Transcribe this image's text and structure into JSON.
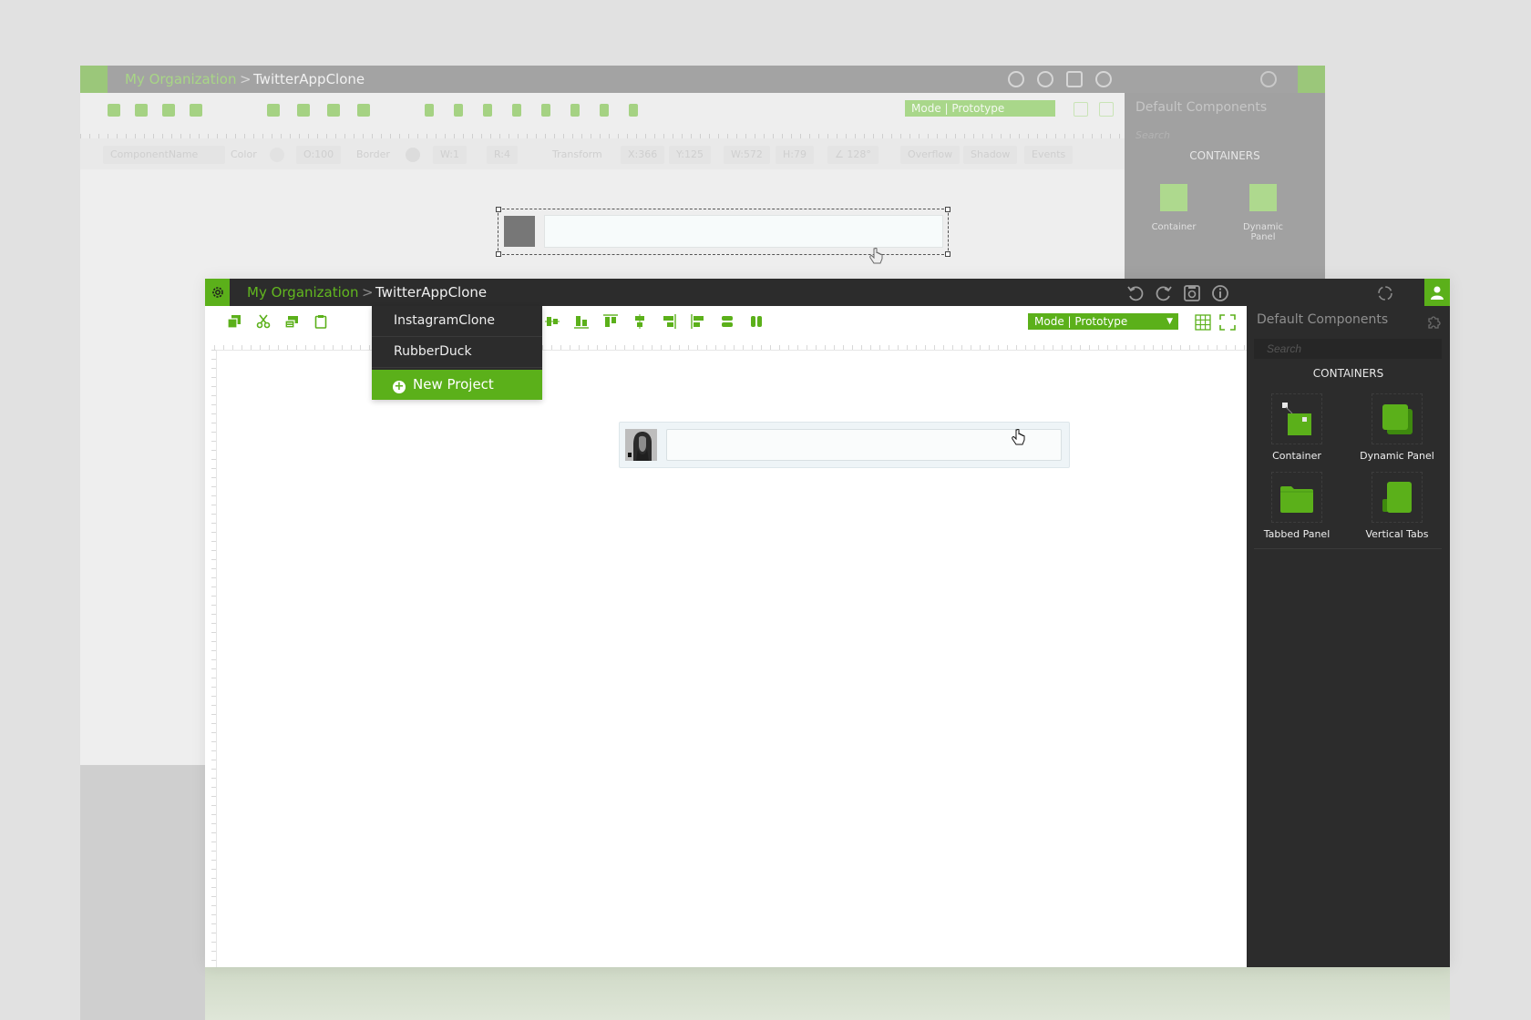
{
  "background_window": {
    "org": "My Organization",
    "separator": ">",
    "project": "TwitterAppClone",
    "mode": "Mode | Prototype",
    "sidebar_title": "Default Components",
    "search_placeholder": "Search",
    "section": "CONTAINERS",
    "components": [
      "Container",
      "Dynamic Panel"
    ],
    "props": {
      "name": "ComponentName",
      "color": "Color",
      "opacity": "O:100",
      "border": "Border",
      "width_line": "W:1",
      "radius": "R:4",
      "transform": "Transform",
      "x": "X:366",
      "y": "Y:125",
      "w": "W:572",
      "h": "H:79",
      "angle": "∠ 128°",
      "overflow": "Overflow",
      "shadow": "Shadow",
      "events": "Events"
    }
  },
  "topbar": {
    "org": "My Organization",
    "separator": ">",
    "project": "TwitterAppClone"
  },
  "project_dropdown": {
    "items": [
      "InstagramClone",
      "RubberDuck"
    ],
    "new_project": "New Project"
  },
  "toolbar": {
    "mode": "Mode | Prototype"
  },
  "canvas": {
    "input_value": ""
  },
  "sidebar": {
    "title": "Default Components",
    "search_placeholder": "Search",
    "section": "CONTAINERS",
    "components": [
      {
        "label": "Container",
        "icon": "container-icon"
      },
      {
        "label": "Dynamic Panel",
        "icon": "dynamic-panel-icon"
      },
      {
        "label": "Tabbed Panel",
        "icon": "tabbed-panel-icon"
      },
      {
        "label": "Vertical Tabs",
        "icon": "vertical-tabs-icon"
      }
    ]
  },
  "colors": {
    "accent": "#5bb01a",
    "topbar": "#2c2c2c",
    "sidebar": "#2c2c2c"
  }
}
